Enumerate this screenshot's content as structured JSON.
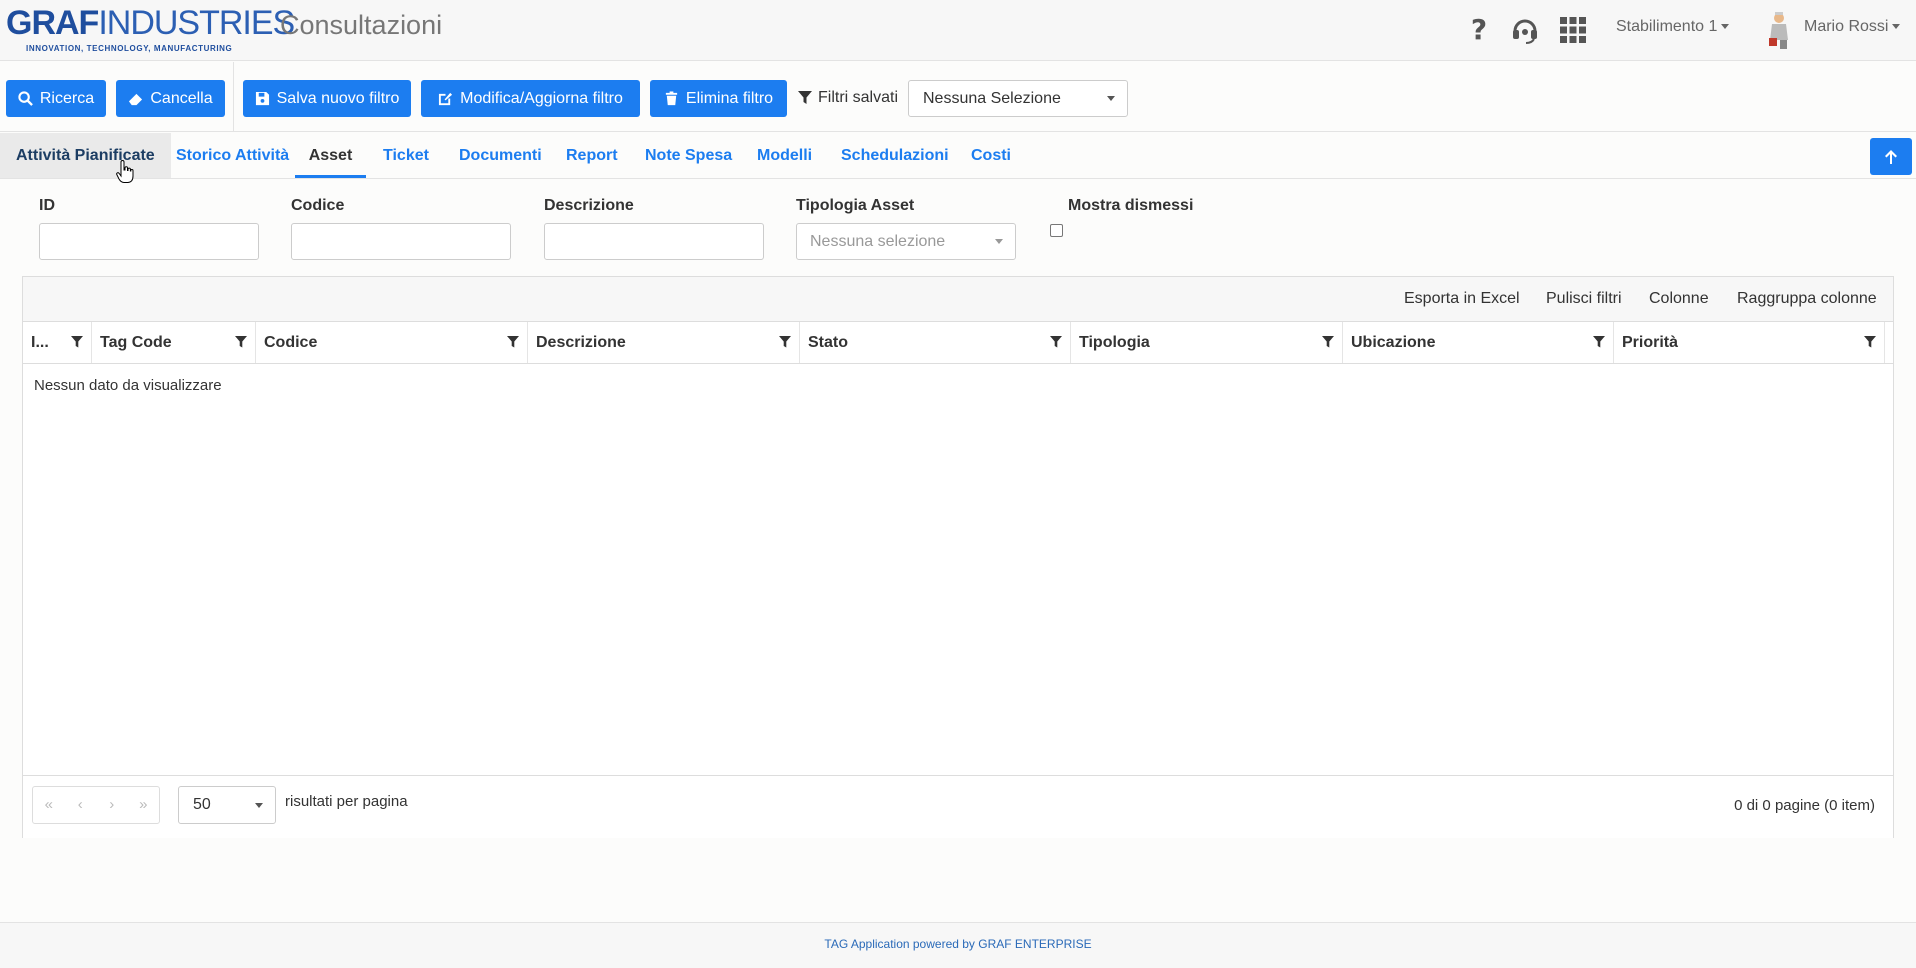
{
  "header": {
    "logo_main_bold": "GRAF",
    "logo_main_thin": "INDUSTRIES",
    "logo_tagline": "INNOVATION, TECHNOLOGY, MANUFACTURING",
    "title": "Consultazioni",
    "icons": [
      "help-icon",
      "headset-icon",
      "apps-icon"
    ],
    "plant": "Stabilimento 1",
    "user": "Mario Rossi"
  },
  "toolbar": {
    "ricerca": "Ricerca",
    "cancella": "Cancella",
    "salva": "Salva nuovo filtro",
    "modifica": "Modifica/Aggiorna filtro",
    "elimina": "Elimina filtro",
    "filtri_salvati": "Filtri salvati",
    "selected_filter": "Nessuna Selezione"
  },
  "tabs": [
    {
      "label": "Attività Pianificate",
      "state": "hover"
    },
    {
      "label": "Storico Attività"
    },
    {
      "label": "Asset",
      "state": "active"
    },
    {
      "label": "Ticket"
    },
    {
      "label": "Documenti"
    },
    {
      "label": "Report"
    },
    {
      "label": "Note Spesa"
    },
    {
      "label": "Modelli"
    },
    {
      "label": "Schedulazioni"
    },
    {
      "label": "Costi"
    }
  ],
  "filters": {
    "id_label": "ID",
    "id_value": "",
    "codice_label": "Codice",
    "codice_value": "",
    "descrizione_label": "Descrizione",
    "descrizione_value": "",
    "tipologia_label": "Tipologia Asset",
    "tipologia_placeholder": "Nessuna selezione",
    "dismessi_label": "Mostra dismessi",
    "dismessi_checked": false
  },
  "grid": {
    "toolbar": [
      "Esporta in Excel",
      "Pulisci filtri",
      "Colonne",
      "Raggruppa colonne"
    ],
    "columns": [
      "I...",
      "Tag Code",
      "Codice",
      "Descrizione",
      "Stato",
      "Tipologia",
      "Ubicazione",
      "Priorità"
    ],
    "empty_message": "Nessun dato da visualizzare",
    "page_size": "50",
    "per_page_label": "risultati per pagina",
    "page_info": "0 di 0 pagine (0 item)"
  },
  "footer": "TAG Application powered by GRAF ENTERPRISE",
  "colors": {
    "primary": "#1c7df0",
    "brand": "#1f4e9e"
  }
}
